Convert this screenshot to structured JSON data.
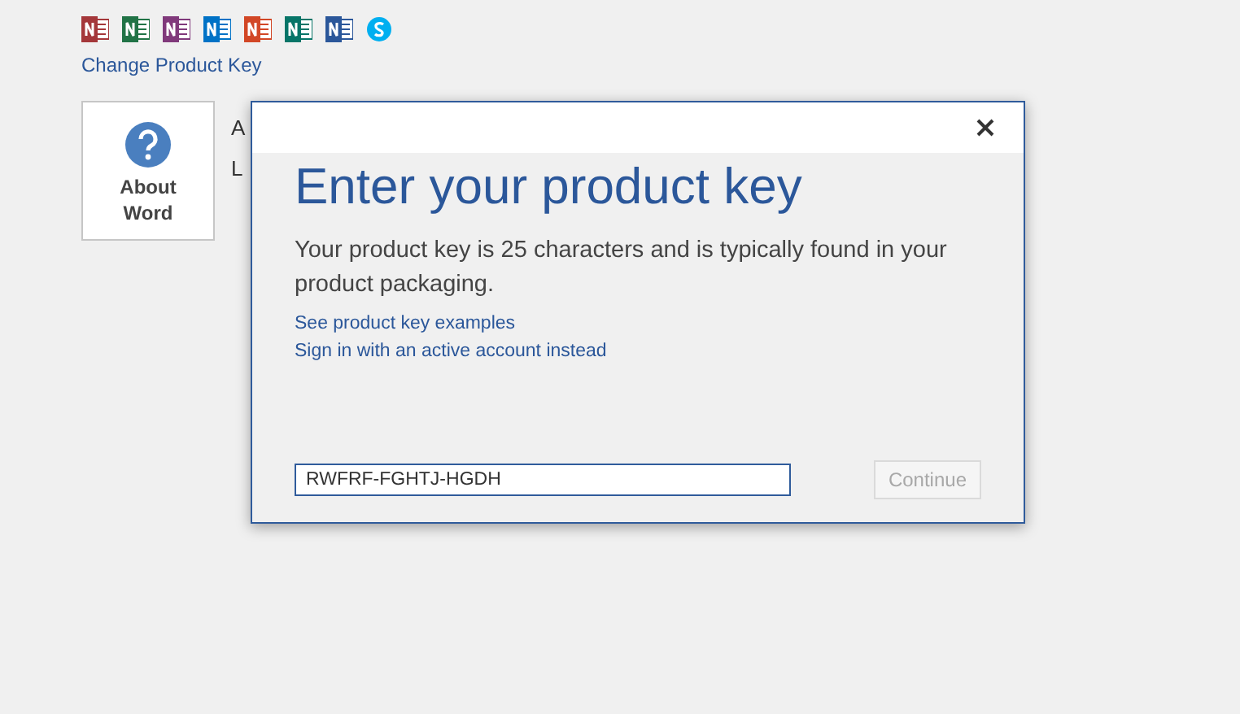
{
  "apps": [
    {
      "kind": "square",
      "color": "#a4373a"
    },
    {
      "kind": "square",
      "color": "#217346"
    },
    {
      "kind": "square",
      "color": "#80397b"
    },
    {
      "kind": "square",
      "color": "#0072c6"
    },
    {
      "kind": "square",
      "color": "#d24726"
    },
    {
      "kind": "square",
      "color": "#077568"
    },
    {
      "kind": "square",
      "color": "#2b579a"
    },
    {
      "kind": "round",
      "color": "#00aff0"
    }
  ],
  "change_key_link": "Change Product Key",
  "about_tile": {
    "label": "About Word"
  },
  "behind_lines": [
    "A",
    "L"
  ],
  "dialog": {
    "title": "Enter your product key",
    "description": "Your product key is 25 characters and is typically found in your product packaging.",
    "links": [
      "See product key examples",
      "Sign in with an active account instead"
    ],
    "key_field": {
      "value": "RWFRF-FGHTJ-HGDH"
    },
    "continue_button": {
      "label": "Continue",
      "disabled": true
    }
  }
}
